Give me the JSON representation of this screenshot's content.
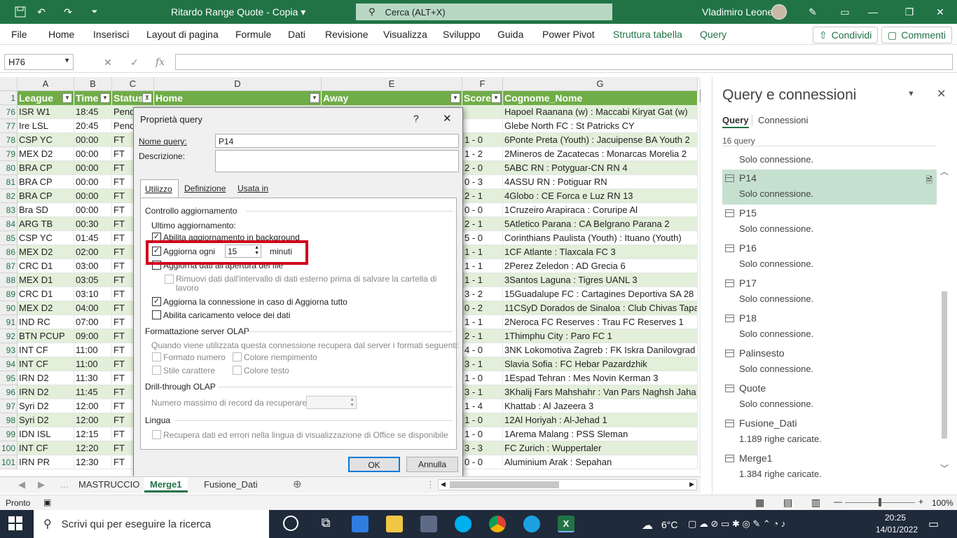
{
  "titlebar": {
    "file_name": "Ritardo Range Quote - Copia",
    "search": "Cerca (ALT+X)",
    "user": "Vladimiro Leone"
  },
  "menu": {
    "items": [
      "File",
      "Home",
      "Inserisci",
      "Layout di pagina",
      "Formule",
      "Dati",
      "Revisione",
      "Visualizza",
      "Sviluppo",
      "Guida",
      "Power Pivot",
      "Struttura tabella",
      "Query"
    ],
    "share": "Condividi",
    "comments": "Commenti"
  },
  "formula": {
    "namebox": "H76",
    "fx": "fx",
    "value": ""
  },
  "grid": {
    "columns": [
      "A",
      "B",
      "C",
      "D",
      "E",
      "F",
      "G"
    ],
    "header_row": "1",
    "headers": [
      "League",
      "Time",
      "Status",
      "Home",
      "Away",
      "Score",
      "Cognome_Nome"
    ],
    "rows": [
      {
        "n": "76",
        "a": "ISR W1",
        "b": "18:45",
        "c": "Pend",
        "f": "",
        "g": "Hapoel Raanana (w) : Maccabi Kiryat Gat (w)"
      },
      {
        "n": "77",
        "a": "Ire LSL",
        "b": "20:45",
        "c": "Pend",
        "f": "",
        "g": "Glebe North FC : St Patricks CY"
      },
      {
        "n": "78",
        "a": "CSP YC",
        "b": "00:00",
        "c": "FT",
        "f": "1 - 0",
        "g": "6Ponte Preta (Youth) : Jacuipense BA Youth 2"
      },
      {
        "n": "79",
        "a": "MEX D2",
        "b": "00:00",
        "c": "FT",
        "f": "1 - 2",
        "g": "2Mineros de Zacatecas : Monarcas Morelia 2"
      },
      {
        "n": "80",
        "a": "BRA CP",
        "b": "00:00",
        "c": "FT",
        "f": "2 - 0",
        "g": "5ABC RN : Potyguar-CN RN 4"
      },
      {
        "n": "81",
        "a": "BRA CP",
        "b": "00:00",
        "c": "FT",
        "f": "0 - 3",
        "g": "4ASSU RN : Potiguar RN"
      },
      {
        "n": "82",
        "a": "BRA CP",
        "b": "00:00",
        "c": "FT",
        "f": "2 - 1",
        "g": "4Globo : CE Forca e Luz RN 13"
      },
      {
        "n": "83",
        "a": "Bra SD",
        "b": "00:00",
        "c": "FT",
        "f": "0 - 0",
        "g": "1Cruzeiro Arapiraca : Coruripe Al"
      },
      {
        "n": "84",
        "a": "ARG TB",
        "b": "00:30",
        "c": "FT",
        "f": "2 - 1",
        "g": "5Atletico Parana : CA Belgrano Parana 2"
      },
      {
        "n": "85",
        "a": "CSP YC",
        "b": "01:45",
        "c": "FT",
        "f": "5 - 0",
        "g": "Corinthians Paulista (Youth) : Ituano (Youth)"
      },
      {
        "n": "86",
        "a": "MEX D2",
        "b": "02:00",
        "c": "FT",
        "f": "1 - 1",
        "g": "1CF Atlante : Tlaxcala FC 3"
      },
      {
        "n": "87",
        "a": "CRC D1",
        "b": "03:00",
        "c": "FT",
        "f": "1 - 1",
        "g": "2Perez Zeledon : AD Grecia 6"
      },
      {
        "n": "88",
        "a": "MEX D1",
        "b": "03:05",
        "c": "FT",
        "f": "1 - 1",
        "g": "3Santos Laguna : Tigres UANL 3"
      },
      {
        "n": "89",
        "a": "CRC D1",
        "b": "03:10",
        "c": "FT",
        "f": "3 - 2",
        "g": "15Guadalupe FC : Cartagines Deportiva SA 28"
      },
      {
        "n": "90",
        "a": "MEX D2",
        "b": "04:00",
        "c": "FT",
        "f": "0 - 2",
        "g": "11CSyD Dorados de Sinaloa : Club Chivas Tapa"
      },
      {
        "n": "91",
        "a": "IND RC",
        "b": "07:00",
        "c": "FT",
        "f": "1 - 1",
        "g": "2Neroca FC Reserves : Trau FC Reserves 1"
      },
      {
        "n": "92",
        "a": "BTN PCUP",
        "b": "09:00",
        "c": "FT",
        "f": "2 - 1",
        "g": "1Thimphu City : Paro FC 1"
      },
      {
        "n": "93",
        "a": "INT CF",
        "b": "11:00",
        "c": "FT",
        "f": "4 - 0",
        "g": "3NK Lokomotiva Zagreb : FK Iskra Danilovgrad"
      },
      {
        "n": "94",
        "a": "INT CF",
        "b": "11:00",
        "c": "FT",
        "f": "3 - 1",
        "g": "Slavia Sofia : FC Hebar Pazardzhik"
      },
      {
        "n": "95",
        "a": "IRN D2",
        "b": "11:30",
        "c": "FT",
        "f": "1 - 0",
        "g": "1Espad Tehran : Mes Novin Kerman 3"
      },
      {
        "n": "96",
        "a": "IRN D2",
        "b": "11:45",
        "c": "FT",
        "f": "3 - 1",
        "g": "3Khalij Fars Mahshahr : Van Pars Naghsh Jaha"
      },
      {
        "n": "97",
        "a": "Syri D2",
        "b": "12:00",
        "c": "FT",
        "f": "1 - 4",
        "g": "Khattab : Al Jazeera 3"
      },
      {
        "n": "98",
        "a": "Syri D2",
        "b": "12:00",
        "c": "FT",
        "f": "1 - 0",
        "g": "12Al Horiyah : Al-Jehad 1"
      },
      {
        "n": "99",
        "a": "IDN ISL",
        "b": "12:15",
        "c": "FT",
        "f": "1 - 0",
        "g": "1Arema Malang : PSS Sleman"
      },
      {
        "n": "100",
        "a": "INT CF",
        "b": "12:20",
        "c": "FT",
        "f": "3 - 3",
        "g": "FC Zurich : Wuppertaler"
      },
      {
        "n": "101",
        "a": "IRN PR",
        "b": "12:30",
        "c": "FT",
        "f": "0 - 0",
        "g": "Aluminium Arak : Sepahan"
      }
    ]
  },
  "dialog": {
    "title": "Proprietà query",
    "help": "?",
    "close": "✕",
    "name_label": "Nome query:",
    "name_value": "P14",
    "desc_label": "Descrizione:",
    "tabs": [
      "Utilizzo",
      "Definizione",
      "Usata in"
    ],
    "refresh_group": "Controllo aggiornamento",
    "last_update": "Ultimo aggiornamento:",
    "bg_refresh": "Abilita aggiornamento in background",
    "refresh_every": "Aggiorna ogni",
    "refresh_minutes": "15",
    "minutes": "minuti",
    "refresh_on_open": "Aggiorna dati all'apertura del file",
    "remove_data": "Rimuovi dati dall'intervallo di dati esterno prima di salvare la cartella di lavoro",
    "refresh_all": "Aggiorna la connessione in caso di Aggiorna tutto",
    "fast_load": "Abilita caricamento veloce dei dati",
    "olap_group": "Formattazione server OLAP",
    "olap_desc": "Quando viene utilizzata questa connessione recupera dal server i formati seguenti:",
    "num_format": "Formato numero",
    "fill_color": "Colore riempimento",
    "font_style": "Stile carattere",
    "text_color": "Colore testo",
    "drill_group": "Drill-through OLAP",
    "max_records": "Numero massimo di record da recuperare:",
    "lang_group": "Lingua",
    "lang_desc": "Recupera dati ed errori nella lingua di visualizzazione di Office se disponibile",
    "ok": "OK",
    "cancel": "Annulla"
  },
  "pane": {
    "title": "Query e connessioni",
    "tab_query": "Query",
    "tab_conn": "Connessioni",
    "count": "16 query",
    "top_status": "Solo connessione.",
    "items": [
      {
        "name": "P14",
        "status": "Solo connessione."
      },
      {
        "name": "P15",
        "status": "Solo connessione."
      },
      {
        "name": "P16",
        "status": "Solo connessione."
      },
      {
        "name": "P17",
        "status": "Solo connessione."
      },
      {
        "name": "P18",
        "status": "Solo connessione."
      },
      {
        "name": "Palinsesto",
        "status": "Solo connessione."
      },
      {
        "name": "Quote",
        "status": "Solo connessione."
      },
      {
        "name": "Fusione_Dati",
        "status": "1.189 righe caricate."
      },
      {
        "name": "Merge1",
        "status": "1.384 righe caricate."
      }
    ]
  },
  "sheets": {
    "tabs": [
      "MASTRUCCIO",
      "Merge1",
      "Fusione_Dati"
    ],
    "active": "Merge1"
  },
  "status": {
    "ready": "Pronto",
    "zoom": "100%"
  },
  "taskbar": {
    "search": "Scrivi qui per eseguire la ricerca",
    "weather": "6°C",
    "time": "20:25",
    "date": "14/01/2022"
  },
  "colors": {
    "excel_green": "#217346",
    "table_header": "#70ad47",
    "highlight": "#d0021b",
    "selected_query": "#c6e0d0"
  }
}
